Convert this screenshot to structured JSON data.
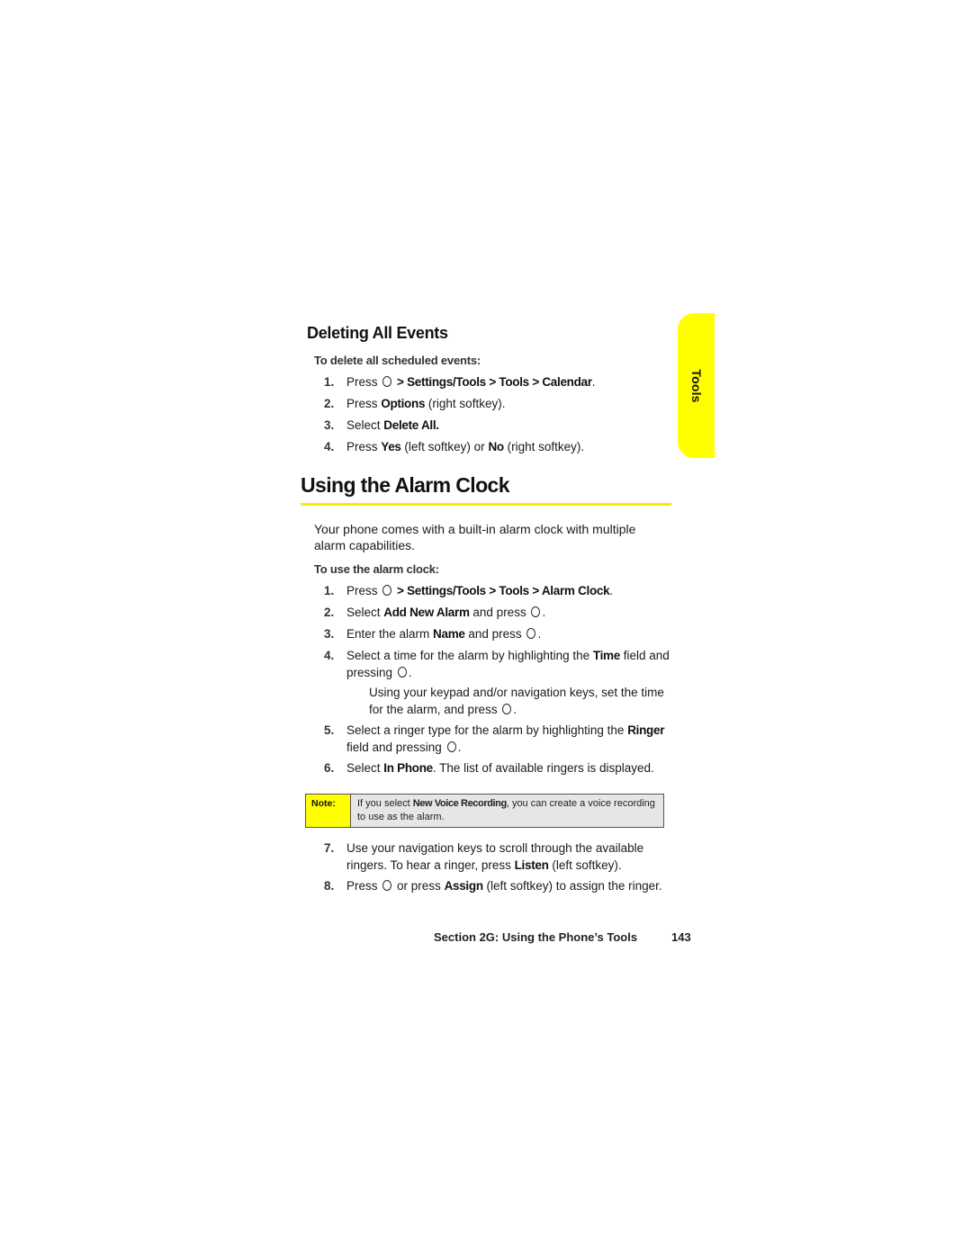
{
  "side_tab": {
    "label": "Tools",
    "color": "#ffff00"
  },
  "deleting": {
    "heading": "Deleting All Events",
    "lead": "To delete all scheduled events:",
    "steps": [
      {
        "num": "1.",
        "pre": "Press",
        "key": "menu-ok-key",
        "bold": "> Settings/Tools > Tools > Calendar",
        "post": "."
      },
      {
        "num": "2.",
        "pre": "Press ",
        "bold": "Options",
        "post": " (right softkey)."
      },
      {
        "num": "3.",
        "pre": "Select ",
        "bold": "Delete All."
      },
      {
        "num": "4.",
        "pre": "Press ",
        "bold": "Yes",
        "mid": " (left softkey) or ",
        "bold2": "No",
        "post": " (right softkey)."
      }
    ]
  },
  "alarm": {
    "heading": "Using the Alarm Clock",
    "accent": "#ffe600",
    "intro": "Your phone comes with a built-in alarm clock with multiple alarm capabilities.",
    "lead": "To use the alarm clock:",
    "steps": [
      {
        "num": "1.",
        "pre": "Press",
        "bold": "> Settings/Tools > Tools > Alarm Clock",
        "post": "."
      },
      {
        "num": "2.",
        "pre": "Select ",
        "bold": "Add New Alarm",
        "post": " and press"
      },
      {
        "num": "3.",
        "pre": "Enter the alarm ",
        "bold": "Name",
        "post": " and press"
      },
      {
        "num": "4.",
        "pre": "Select a time for the alarm by highlighting the ",
        "bold": "Time",
        "post": " field and pressing"
      },
      {
        "num": "5.",
        "pre": "Select a ringer type for the alarm by highlighting the ",
        "bold": "Ringer",
        "post": " field and pressing"
      },
      {
        "num": "6.",
        "pre": "Select ",
        "bold": "In Phone",
        "post": ". The list of available ringers is displayed."
      },
      {
        "num": "7.",
        "pre": "Use your navigation keys to scroll through the available ringers. To hear a ringer, press ",
        "bold": "Listen",
        "post": " (left softkey)."
      },
      {
        "num": "8.",
        "pre": "Press",
        "mid": " or press ",
        "bold": "Assign",
        "post": " (left softkey) to assign the ringer."
      }
    ],
    "step4_sub": "Using your keypad and/or navigation keys, set the time for the alarm, and press",
    "note": {
      "label": "Note:",
      "pre": "If you select ",
      "bold": "New Voice Recording",
      "post": ", you can create a voice recording to use as the alarm."
    }
  },
  "footer": {
    "section": "Section 2G: Using the Phone’s Tools",
    "page": "143"
  }
}
